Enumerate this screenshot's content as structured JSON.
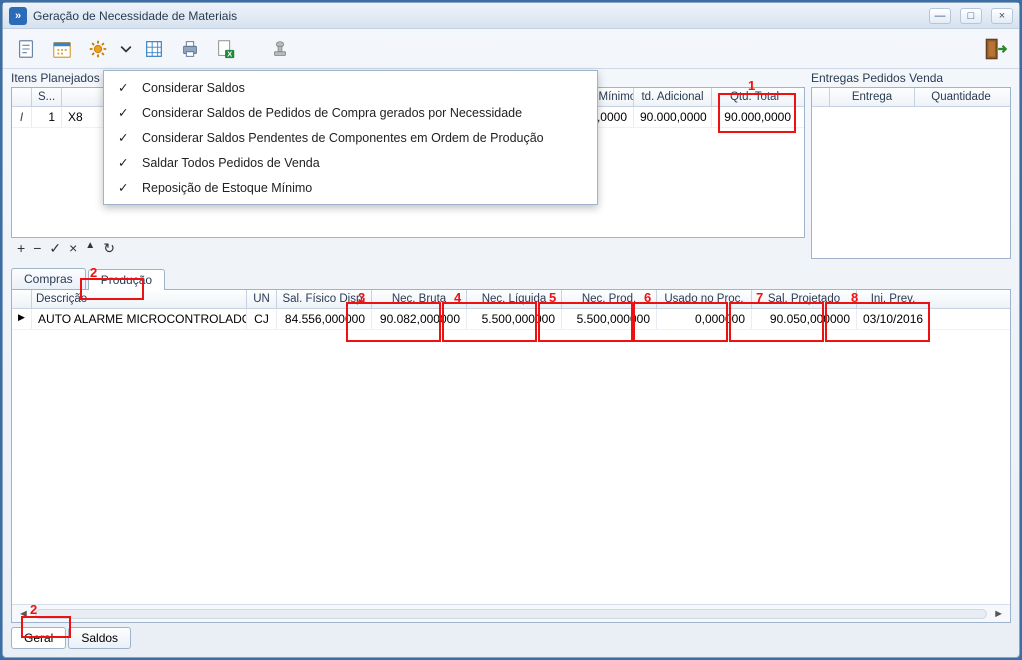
{
  "window": {
    "title": "Geração de Necessidade de Materiais"
  },
  "sections": {
    "planned": "Itens Planejados",
    "deliveries": "Entregas Pedidos Venda"
  },
  "planned_table": {
    "headers": {
      "row": "",
      "seq": "S...",
      "code": "",
      "rep_est_min": "Rep. Est. Mínimo",
      "td_adicional": "td. Adicional",
      "qtd_total": "Qtd. Total"
    },
    "row": {
      "indicator": "I",
      "seq": "1",
      "code": "X8",
      "rep_est_min": "0,0000",
      "td_adicional": "90.000,0000",
      "qtd_total": "90.000,0000"
    }
  },
  "deliveries_table": {
    "headers": {
      "entrega": "Entrega",
      "quantidade": "Quantidade"
    }
  },
  "dropdown": {
    "items": [
      "Considerar Saldos",
      "Considerar Saldos de Pedidos de Compra gerados por Necessidade",
      "Considerar Saldos Pendentes de Componentes em Ordem de Produção",
      "Saldar Todos Pedidos de Venda",
      "Reposição de Estoque Mínimo"
    ]
  },
  "tabs_mid": {
    "compras": "Compras",
    "producao": "Produção"
  },
  "prod_table": {
    "headers": {
      "descricao": "Descrição",
      "un": "UN",
      "sal_fisico": "Sal. Físico Disp.",
      "nec_bruta": "Nec. Bruta",
      "nec_liquida": "Nec. Líquida",
      "nec_prod": "Nec. Prod.",
      "usado_proc": "Usado no Proc.",
      "sal_projetado": "Sal. Projetado",
      "ini_prev": "Ini. Prev."
    },
    "row": {
      "indicator": "▶",
      "descricao": "AUTO ALARME MICROCONTROLADO...",
      "un": "CJ",
      "sal_fisico": "84.556,000000",
      "nec_bruta": "90.082,000000",
      "nec_liquida": "5.500,000000",
      "nec_prod": "5.500,000000",
      "usado_proc": "0,000000",
      "sal_projetado": "90.050,000000",
      "ini_prev": "03/10/2016"
    }
  },
  "tabs_bottom": {
    "geral": "Geral",
    "saldos": "Saldos"
  },
  "annotations": {
    "a1": "1",
    "a2": "2",
    "a2b": "2",
    "a3": "3",
    "a4": "4",
    "a5": "5",
    "a6": "6",
    "a7": "7",
    "a8": "8"
  },
  "mini_toolbar": {
    "plus": "+",
    "minus": "−",
    "check": "✓",
    "x": "×",
    "up": "▲",
    "refresh": "↻"
  }
}
